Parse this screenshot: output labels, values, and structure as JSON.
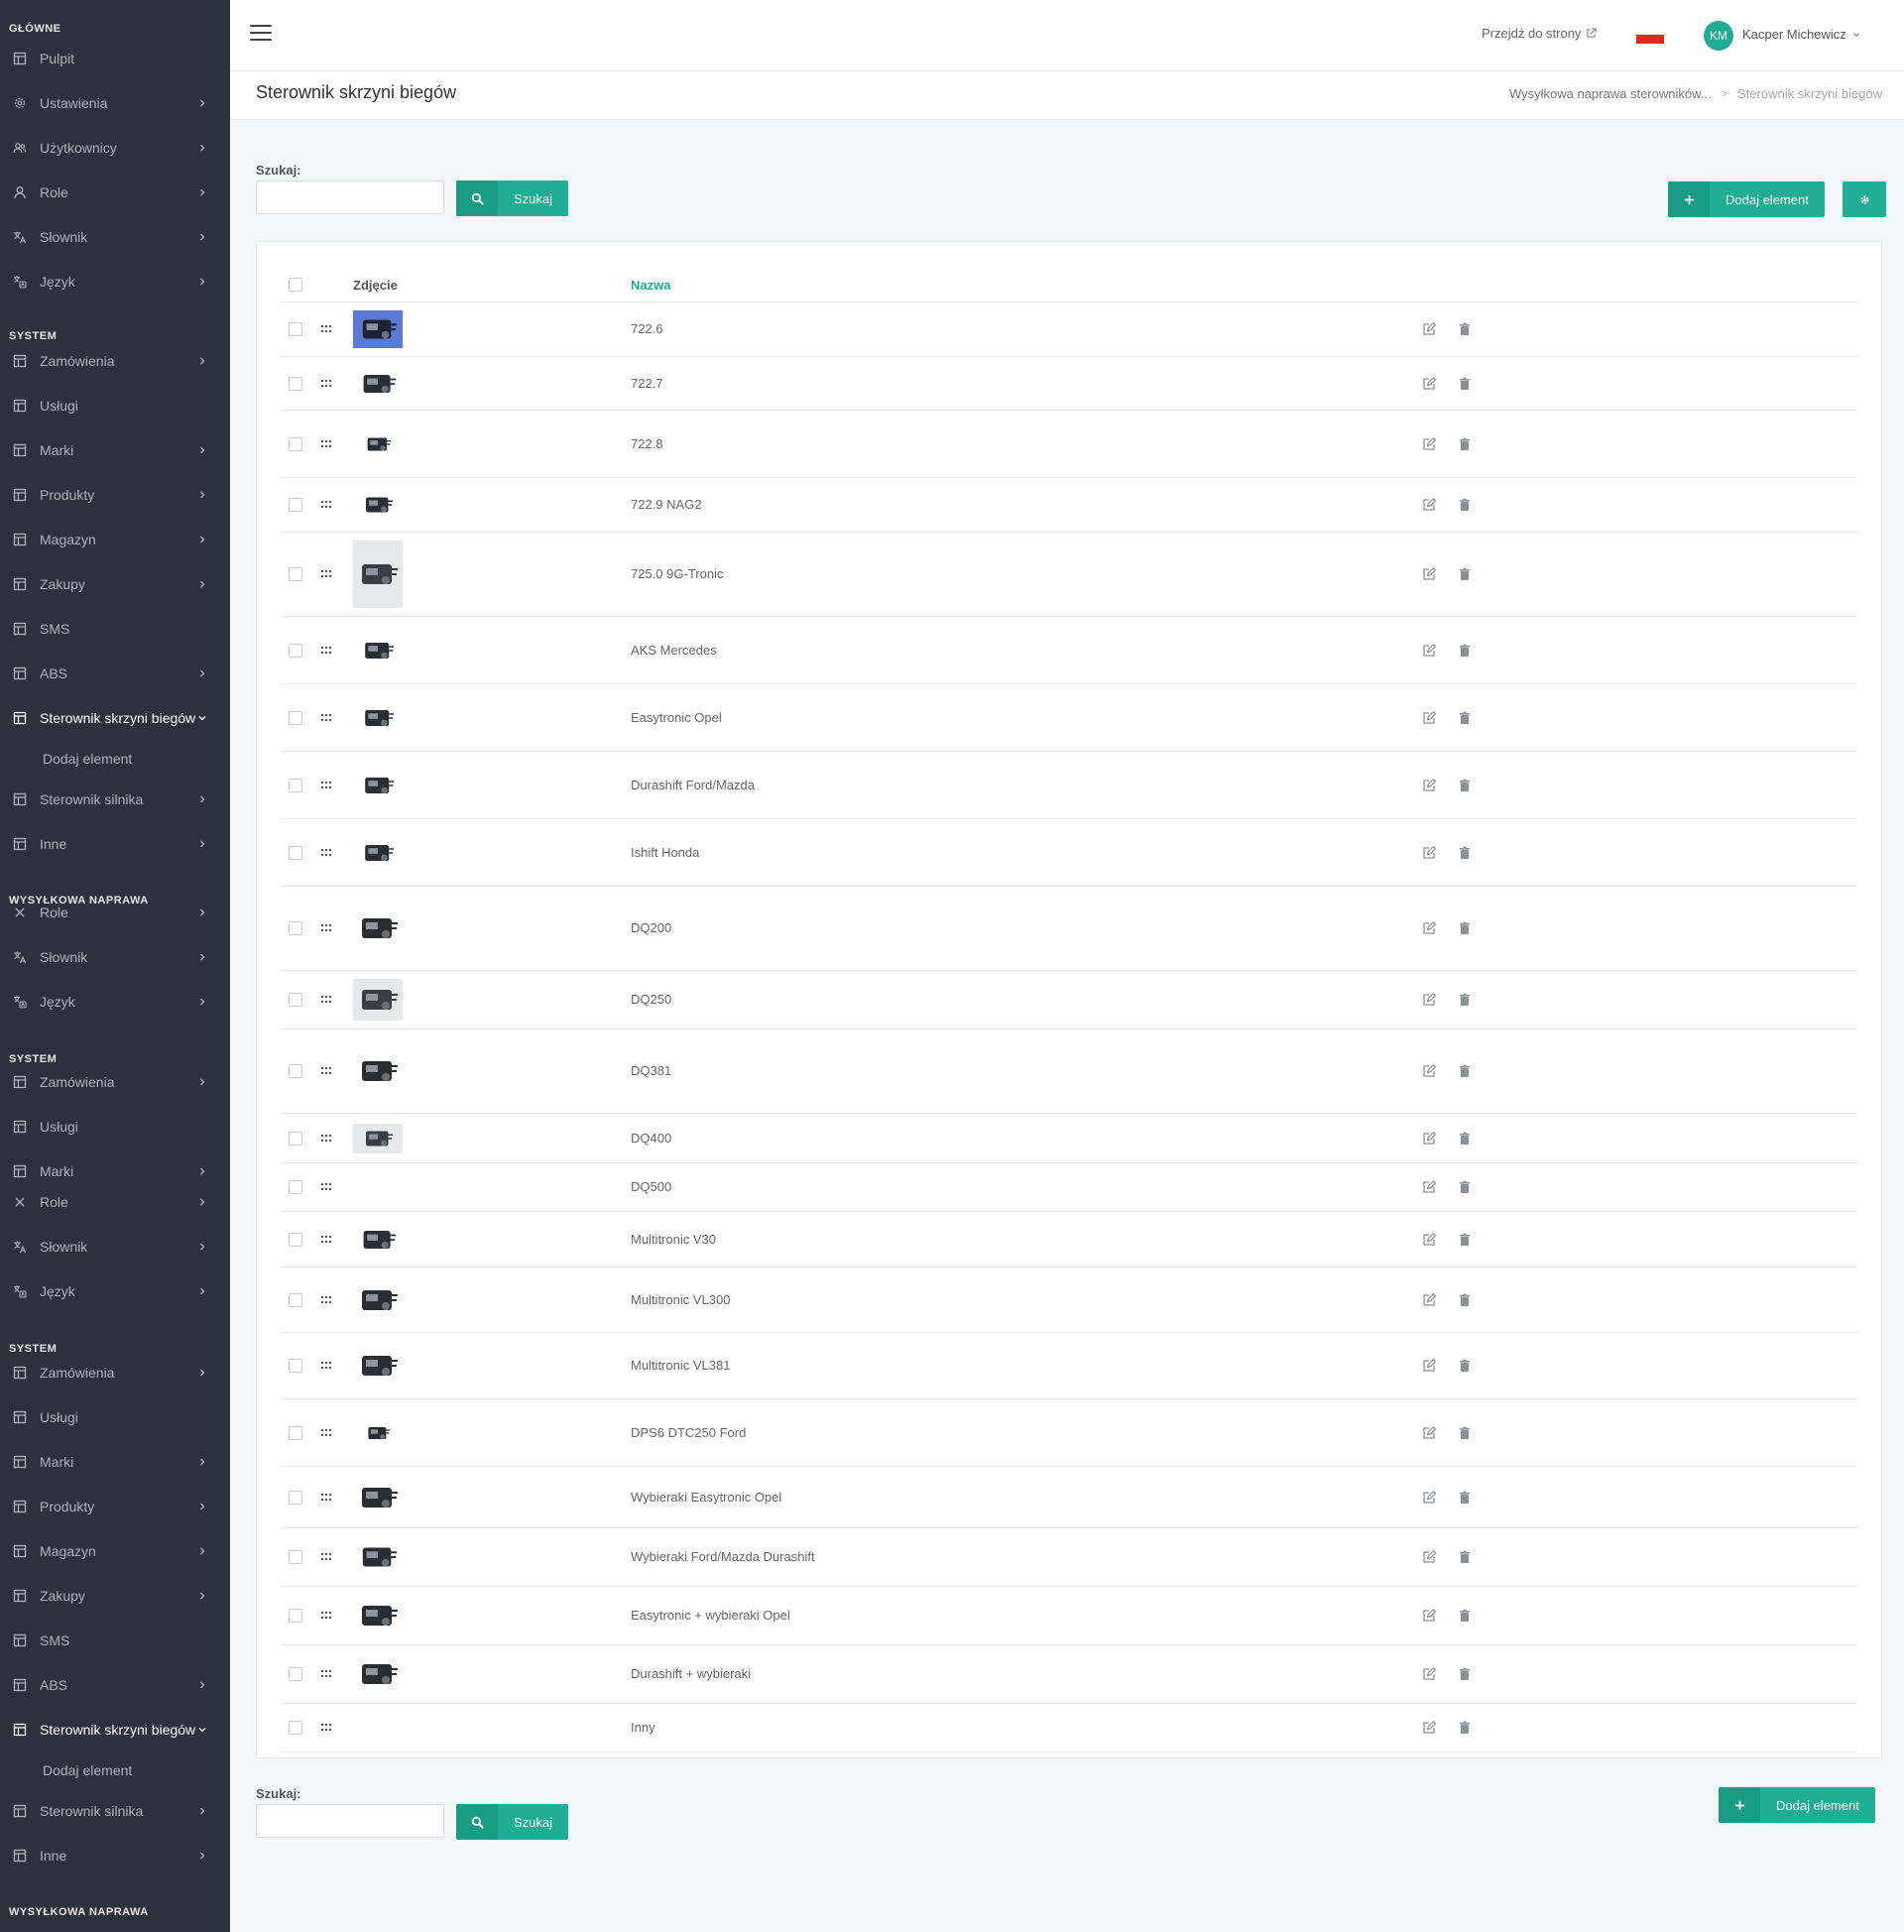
{
  "sidebar": {
    "sections": [
      "GŁÓWNE",
      "SYSTEM",
      "WYSYŁKOWA NAPRAWA",
      "SYSTEM",
      "SYSTEM",
      "WYSYŁKOWA NAPRAWA"
    ],
    "items": [
      {
        "label": "Pulpit",
        "icon": "table-icon",
        "chevron": false
      },
      {
        "label": "Ustawienia",
        "icon": "settings-icon",
        "chevron": true
      },
      {
        "label": "Użytkownicy",
        "icon": "users-icon",
        "chevron": true
      },
      {
        "label": "Role",
        "icon": "user-icon",
        "chevron": true
      },
      {
        "label": "Słownik",
        "icon": "translate-icon",
        "chevron": true
      },
      {
        "label": "Język",
        "icon": "language-icon",
        "chevron": true
      },
      {
        "label": "Zamówienia",
        "icon": "table-icon",
        "chevron": true
      },
      {
        "label": "Usługi",
        "icon": "table-icon",
        "chevron": false
      },
      {
        "label": "Marki",
        "icon": "table-icon",
        "chevron": true
      },
      {
        "label": "Produkty",
        "icon": "table-icon",
        "chevron": true
      },
      {
        "label": "Magazyn",
        "icon": "table-icon",
        "chevron": true
      },
      {
        "label": "Zakupy",
        "icon": "table-icon",
        "chevron": true
      },
      {
        "label": "SMS",
        "icon": "table-icon",
        "chevron": false
      },
      {
        "label": "ABS",
        "icon": "table-icon",
        "chevron": true
      },
      {
        "label": "Sterownik skrzyni biegów",
        "icon": "table-icon",
        "chevron": "down",
        "active": true
      },
      {
        "label": "Dodaj element",
        "sub": true
      },
      {
        "label": "Sterownik silnika",
        "icon": "table-icon",
        "chevron": true
      },
      {
        "label": "Inne",
        "icon": "table-icon",
        "chevron": true
      },
      {
        "label": "Role",
        "icon": "close-icon",
        "chevron": true
      },
      {
        "label": "Słownik",
        "icon": "translate-icon",
        "chevron": true
      },
      {
        "label": "Język",
        "icon": "language-icon",
        "chevron": true
      },
      {
        "label": "Zamówienia",
        "icon": "table-icon",
        "chevron": true
      },
      {
        "label": "Usługi",
        "icon": "table-icon",
        "chevron": false
      },
      {
        "label": "Marki",
        "icon": "table-icon",
        "chevron": true
      },
      {
        "label": "Role",
        "icon": "close-icon",
        "chevron": true
      },
      {
        "label": "Słownik",
        "icon": "translate-icon",
        "chevron": true
      },
      {
        "label": "Język",
        "icon": "language-icon",
        "chevron": true
      },
      {
        "label": "Zamówienia",
        "icon": "table-icon",
        "chevron": true
      },
      {
        "label": "Usługi",
        "icon": "table-icon",
        "chevron": false
      },
      {
        "label": "Marki",
        "icon": "table-icon",
        "chevron": true
      },
      {
        "label": "Produkty",
        "icon": "table-icon",
        "chevron": true
      },
      {
        "label": "Magazyn",
        "icon": "table-icon",
        "chevron": true
      },
      {
        "label": "Zakupy",
        "icon": "table-icon",
        "chevron": true
      },
      {
        "label": "SMS",
        "icon": "table-icon",
        "chevron": false
      },
      {
        "label": "ABS",
        "icon": "table-icon",
        "chevron": true
      },
      {
        "label": "Sterownik skrzyni biegów",
        "icon": "table-icon",
        "chevron": "down",
        "active": true
      },
      {
        "label": "Dodaj element",
        "sub": true
      },
      {
        "label": "Sterownik silnika",
        "icon": "table-icon",
        "chevron": true
      },
      {
        "label": "Inne",
        "icon": "table-icon",
        "chevron": true
      }
    ]
  },
  "topbar": {
    "visit_link": "Przejdź do strony",
    "avatar_initials": "KM",
    "user_name": "Kacper Michewicz"
  },
  "page": {
    "title": "Sterownik skrzyni biegów",
    "breadcrumb": [
      "Wysyłkowa naprawa sterowników...",
      "Sterownik skrzyni biegów"
    ]
  },
  "search": {
    "label": "Szukaj:",
    "button": "Szukaj",
    "placeholder": ""
  },
  "actions": {
    "add_label": "Dodaj element"
  },
  "table": {
    "columns": {
      "photo": "Zdjęcie",
      "name": "Nazwa"
    },
    "rows": [
      {
        "name": "722.6",
        "photo": "blue"
      },
      {
        "name": "722.7",
        "photo": "white"
      },
      {
        "name": "722.8",
        "photo": "white"
      },
      {
        "name": "722.9 NAG2",
        "photo": "white"
      },
      {
        "name": "725.0 9G-Tronic",
        "photo": "grey"
      },
      {
        "name": "AKS Mercedes",
        "photo": "white"
      },
      {
        "name": "Easytronic Opel",
        "photo": "white"
      },
      {
        "name": "Durashift Ford/Mazda",
        "photo": "white"
      },
      {
        "name": "Ishift Honda",
        "photo": "white"
      },
      {
        "name": "DQ200",
        "photo": "white"
      },
      {
        "name": "DQ250",
        "photo": "grey"
      },
      {
        "name": "DQ381",
        "photo": "white"
      },
      {
        "name": "DQ400",
        "photo": "grey"
      },
      {
        "name": "DQ500",
        "photo": "none"
      },
      {
        "name": "Multitronic V30",
        "photo": "white"
      },
      {
        "name": "Multitronic VL300",
        "photo": "white"
      },
      {
        "name": "Multitronic VL381",
        "photo": "white"
      },
      {
        "name": "DPS6 DTC250 Ford",
        "photo": "white"
      },
      {
        "name": "Wybieraki Easytronic Opel",
        "photo": "white"
      },
      {
        "name": "Wybieraki Ford/Mazda Durashift",
        "photo": "white"
      },
      {
        "name": "Easytronic + wybieraki Opel",
        "photo": "white"
      },
      {
        "name": "Durashift + wybieraki",
        "photo": "white"
      },
      {
        "name": "Inny",
        "photo": "none"
      }
    ]
  },
  "colors": {
    "accent": "#1fae93",
    "accent_dark": "#199c84",
    "sidebar_bg": "#2c323c",
    "flag_red": "#dc2b1e"
  }
}
